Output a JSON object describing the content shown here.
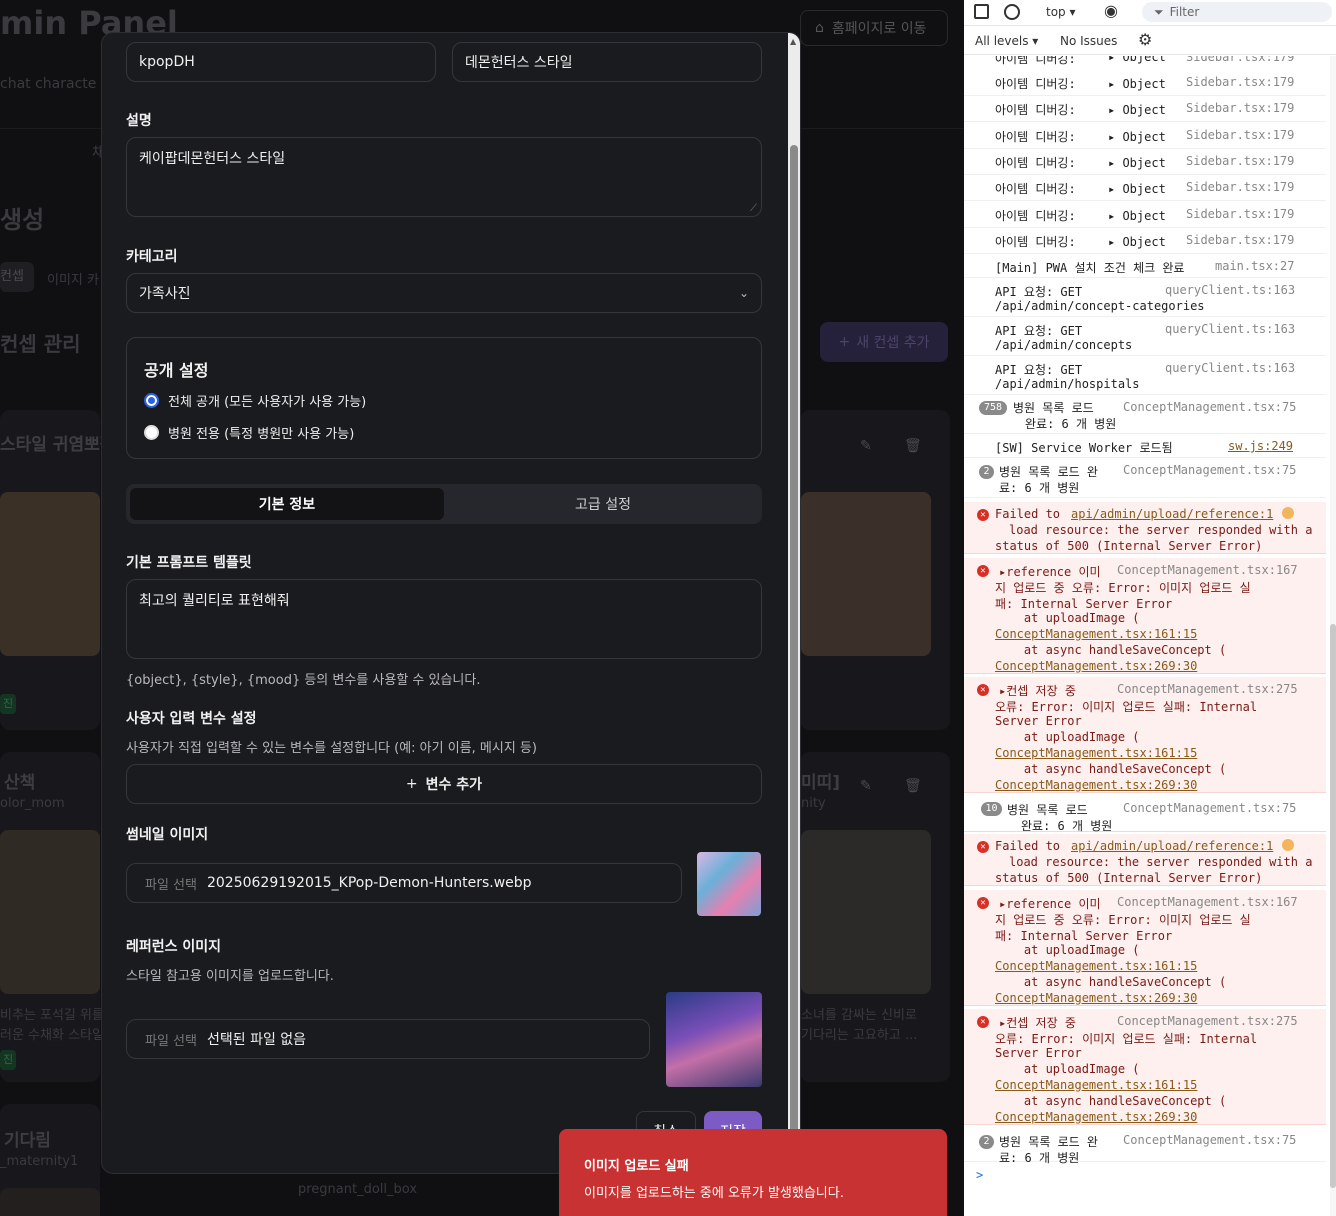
{
  "background": {
    "title": "min Panel",
    "subtitle": " chat characte",
    "home_button": "홈페이지로 이동",
    "section_heading": "생성",
    "tab_concept": "컨셉",
    "tab_image": "이미지 카",
    "list_heading": "컨셉 관리",
    "add_button": "새 컨셉 추가",
    "card1_title": "스타일 귀염뽀짝",
    "card2_title": "산책",
    "card2_sub": "olor_mom",
    "card3_title": "미띠]",
    "card3_sub": "nity",
    "card2_desc1": "비추는 포석길 위를",
    "card2_desc2": "러운 수채화 스타일",
    "card3_desc1": "소녀를 감싸는 신비로",
    "card3_desc2": "기다리는 고요하고 ...",
    "card4_title": "기다림",
    "card4_sub": "_maternity1",
    "card5_sub": "pregnant_doll_box",
    "badge": "진",
    "mid_tab": "채"
  },
  "modal": {
    "concept_id": "kpopDH",
    "concept_title": "데몬헌터스 스타일",
    "description_label": "설명",
    "description_value": "케이팝데몬헌터스 스타일",
    "category_label": "카테고리",
    "category_value": "가족사진",
    "visibility_label": "공개 설정",
    "visibility_public": "전체 공개 (모든 사용자가 사용 가능)",
    "visibility_hospital": "병원 전용 (특정 병원만 사용 가능)",
    "tab_basic": "기본 정보",
    "tab_advanced": "고급 설정",
    "prompt_label": "기본 프롬프트 템플릿",
    "prompt_value": "최고의 퀄리티로 표현해줘",
    "prompt_hint": "{object}, {style}, {mood} 등의 변수를 사용할 수 있습니다.",
    "vars_label": "사용자 입력 변수 설정",
    "vars_hint": "사용자가 직접 입력할 수 있는 변수를 설정합니다 (예: 아기 이름, 메시지 등)",
    "add_var": "변수 추가",
    "thumb_label": "썸네일 이미지",
    "file_btn": "파일 선택",
    "thumb_file": "20250629192015_KPop-Demon-Hunters.webp",
    "ref_label": "레퍼런스 이미지",
    "ref_hint": "스타일 참고용 이미지를 업로드합니다.",
    "ref_file": "선택된 파일 없음",
    "cancel": "취소",
    "save": "저장"
  },
  "toast": {
    "title": "이미지 업로드 실패",
    "message": "이미지를 업로드하는 중에 오류가 발생했습니다."
  },
  "devtools": {
    "context": "top ▾",
    "filter_placeholder": "Filter",
    "levels": "All levels ▾",
    "issues": "No Issues",
    "debug_label": "아이템 디버깅:",
    "object": "Object",
    "sidebar_src": "Sidebar.tsx:179",
    "sidebar_src_top": "Sidebar.tsx:179",
    "pwa_msg": "[Main] PWA 설치 조건 체크 완료",
    "pwa_src": "main.tsx:27",
    "api1_a": "API 요청: GET",
    "api1_b": "/api/admin/concept-categories",
    "api2_b": "/api/admin/concepts",
    "api3_b": "/api/admin/hospitals",
    "qc_src": "queryClient.ts:163",
    "count1": "758",
    "hosp_msg1a": "병원 목록 로드",
    "hosp_msg1b": "완료: 6 개 병원",
    "cm75": "ConceptManagement.tsx:75",
    "sw_msg": "[SW] Service Worker 로드됨",
    "sw_src": "sw.js:249",
    "count2": "2",
    "hosp_msg2a": "병원 목록 로드 완",
    "hosp_msg2b": "료: 6 개 병원",
    "fail_a": "Failed to",
    "fail_link": "api/admin/upload/reference:1",
    "fail_b": "load resource: the server responded with a",
    "fail_c": "status of 500 (Internal Server Error)",
    "ref_a": "▸reference 이미",
    "ref_src": "ConceptManagement.tsx:167",
    "ref_b": "지 업로드 중 오류: Error: 이미지 업로드 실",
    "ref_c": "패: Internal Server Error",
    "at_upload": "    at uploadImage (",
    "cm161": "ConceptManagement.tsx:161:15",
    "at_save": "    at async handleSaveConcept (",
    "cm269": "ConceptManagement.tsx:269:30",
    "save_a": "▸컨셉 저장 중",
    "save_src": "ConceptManagement.tsx:275",
    "save_b": "오류: Error: 이미지 업로드 실패: Internal",
    "save_c": "Server Error",
    "count3": "10",
    "prompt_caret": ">"
  }
}
